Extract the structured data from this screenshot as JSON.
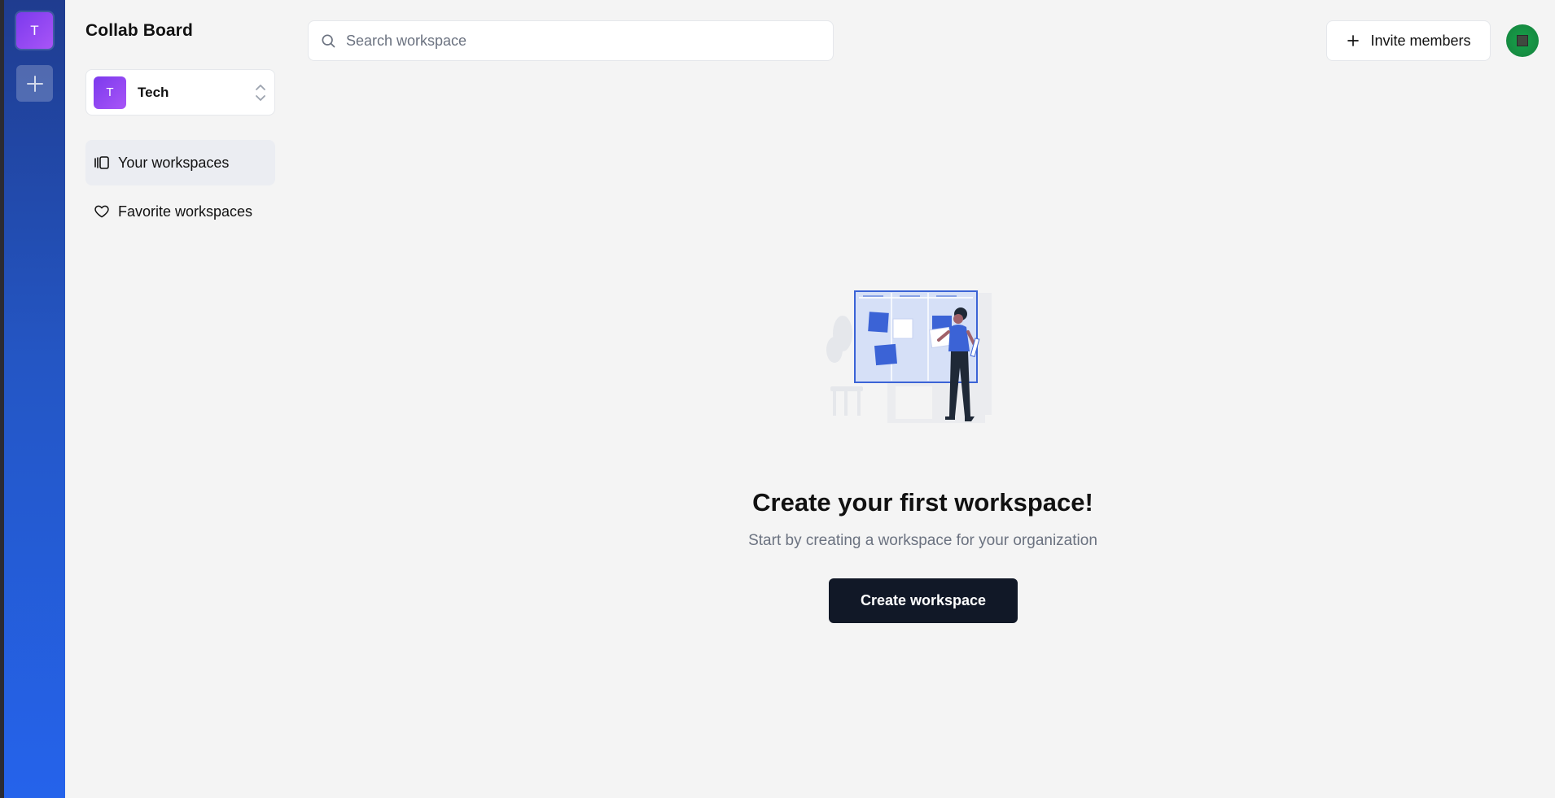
{
  "org_rail": {
    "active_org_initial": "T",
    "add_org_icon": "plus-icon"
  },
  "sidebar": {
    "brand": "Collab Board",
    "org_switcher": {
      "initial": "T",
      "name": "Tech",
      "icon": "chevrons-up-down-icon"
    },
    "nav": [
      {
        "label": "Your workspaces",
        "icon": "workspaces-icon",
        "active": true
      },
      {
        "label": "Favorite workspaces",
        "icon": "heart-icon",
        "active": false
      }
    ]
  },
  "header": {
    "search": {
      "placeholder": "Search workspace",
      "value": "",
      "icon": "search-icon"
    },
    "invite_button": {
      "label": "Invite members",
      "icon": "plus-icon"
    },
    "user_avatar": "user-avatar"
  },
  "empty_state": {
    "illustration": "empty-workspace-illustration",
    "title": "Create your first workspace!",
    "subtitle": "Start by creating a workspace for your organization",
    "cta_label": "Create workspace"
  },
  "colors": {
    "rail_top": "#1f3c8f",
    "rail_bottom": "#2563eb",
    "org_avatar": "#8b5cf6",
    "cta_bg": "#111827",
    "page_bg": "#f4f4f4"
  }
}
